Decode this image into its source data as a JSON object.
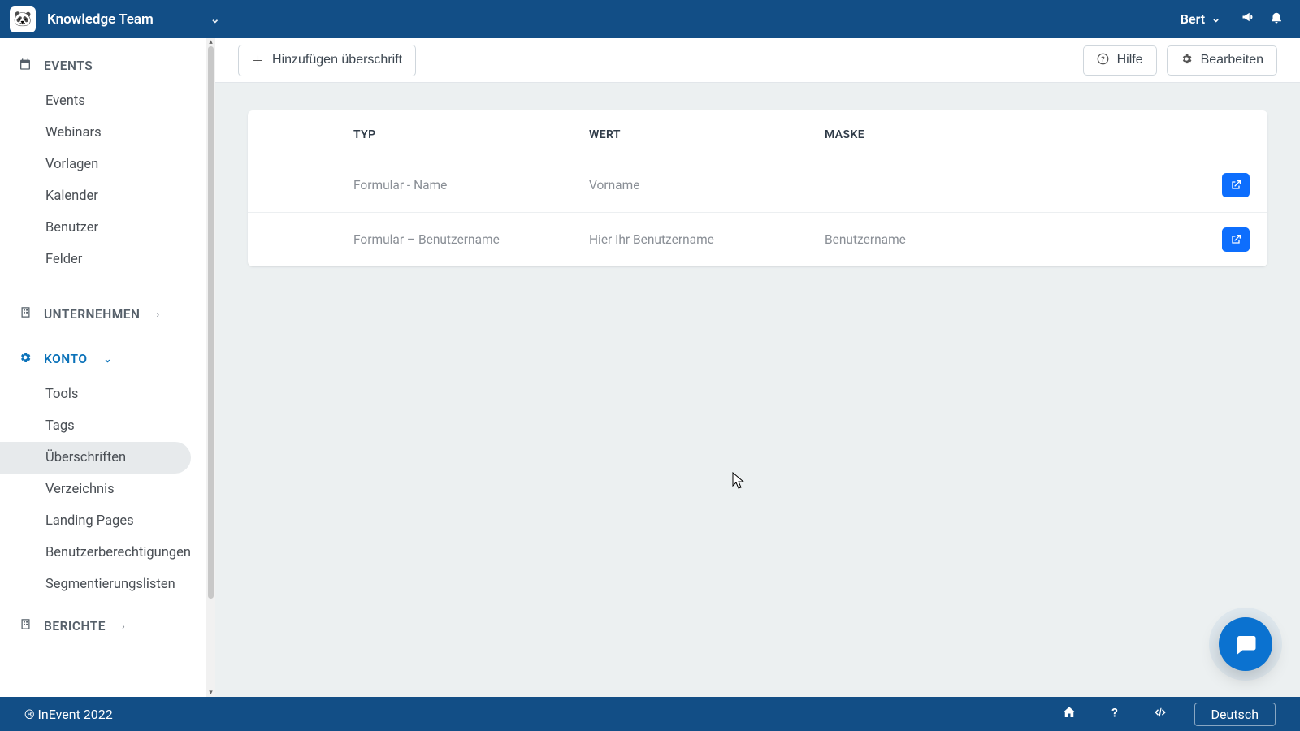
{
  "topbar": {
    "workspace": "Knowledge Team",
    "user": "Bert"
  },
  "sidebar": {
    "sections": [
      {
        "label": "EVENTS",
        "items": [
          "Events",
          "Webinars",
          "Vorlagen",
          "Kalender",
          "Benutzer",
          "Felder"
        ]
      },
      {
        "label": "UNTERNEHMEN",
        "items": []
      },
      {
        "label": "KONTO",
        "items": [
          "Tools",
          "Tags",
          "Überschriften",
          "Verzeichnis",
          "Landing Pages",
          "Benutzerberechtigungen",
          "Segmentierungslisten"
        ]
      },
      {
        "label": "BERICHTE",
        "items": []
      }
    ],
    "active": "Überschriften"
  },
  "actions": {
    "add": "Hinzufügen überschrift",
    "help": "Hilfe",
    "edit": "Bearbeiten"
  },
  "table": {
    "headers": {
      "type": "TYP",
      "value": "WERT",
      "mask": "MASKE"
    },
    "rows": [
      {
        "type": "Formular - Name",
        "value": "Vorname",
        "mask": ""
      },
      {
        "type": "Formular – Benutzername",
        "value": "Hier Ihr Benutzername",
        "mask": "Benutzername"
      }
    ]
  },
  "footer": {
    "copyright": "® InEvent 2022",
    "language": "Deutsch"
  }
}
